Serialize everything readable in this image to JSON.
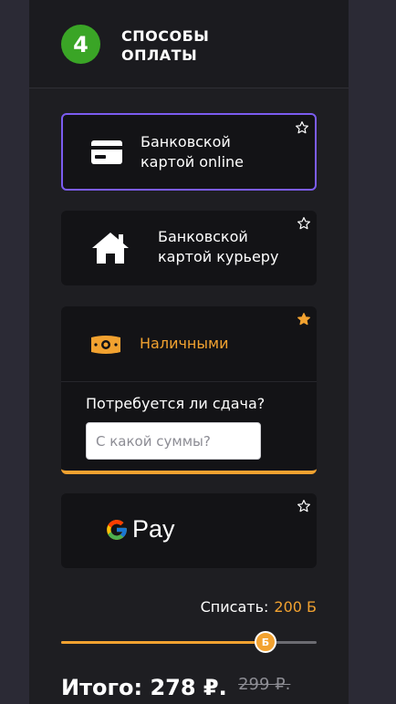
{
  "step": {
    "number": "4",
    "title_line1": "Способы",
    "title_line2": "оплаты"
  },
  "methods": [
    {
      "label_line1": "Банковской",
      "label_line2": "картой online",
      "icon": "credit-card-icon",
      "selected": true,
      "favorite": false
    },
    {
      "label_line1": "Банковской",
      "label_line2": "картой курьеру",
      "icon": "home-icon",
      "selected": false,
      "favorite": false
    },
    {
      "label": "Наличными",
      "icon": "cash-icon",
      "favorite": true,
      "change_question": "Потребуется ли сдача?",
      "change_placeholder": "С какой суммы?"
    },
    {
      "label": "Pay",
      "icon": "google-g-icon",
      "favorite": false
    }
  ],
  "points": {
    "label": "Списать:",
    "value": "200 Б",
    "thumb_symbol": "Б",
    "fraction": 0.8
  },
  "total": {
    "label": "Итого:",
    "amount": "278 ₽.",
    "old_amount": "299 ₽."
  },
  "colors": {
    "accent": "#f2a230",
    "selected_border": "#7b5cf0",
    "step_badge": "#3aa526",
    "card": "#131316",
    "panel": "#1e1e22",
    "background": "#2b2a35"
  }
}
